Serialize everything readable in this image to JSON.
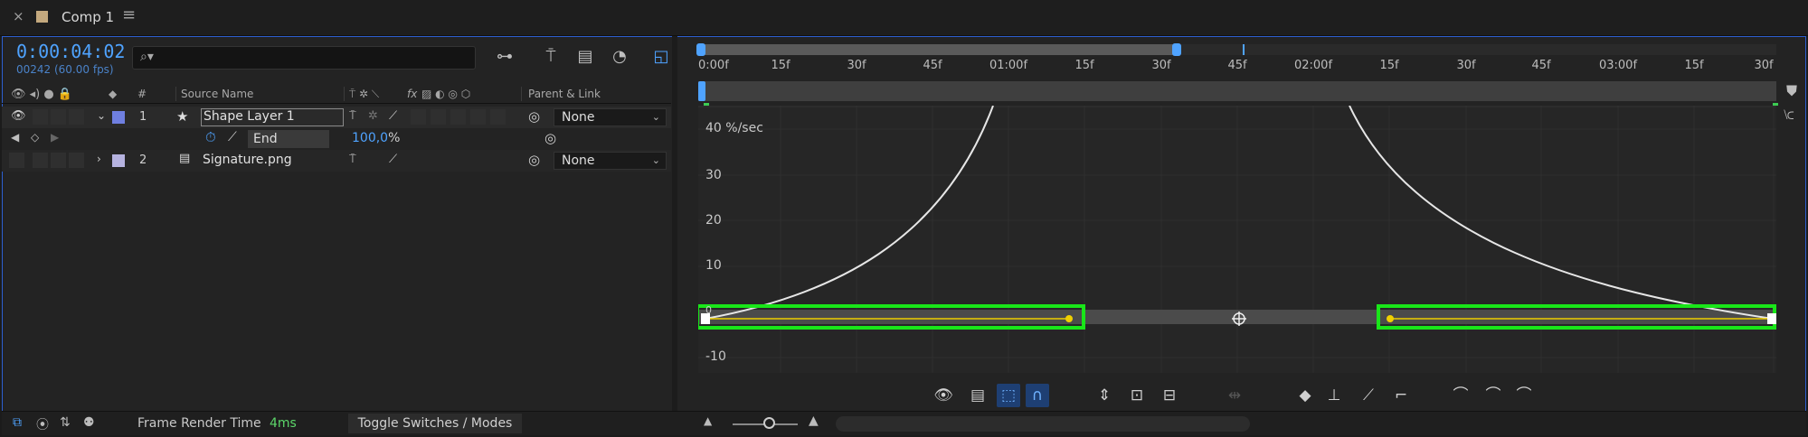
{
  "tab": {
    "close_icon": "close-icon",
    "title": "Comp 1",
    "menu_icon": "hamburger-menu-icon",
    "swatch_color": "#c4a97e"
  },
  "timecode": "0:00:04:02",
  "frame_info": "00242 (60.00 fps)",
  "search": {
    "value": "",
    "icon": "search-icon"
  },
  "toolbar_icons": [
    "composition-flowchart-icon",
    "shy-layers-icon",
    "frame-blending-icon",
    "motion-blur-icon",
    "graph-editor-icon"
  ],
  "columns": {
    "source_name": "Source Name",
    "parent_link": "Parent & Link",
    "number": "#",
    "fx": "fx"
  },
  "layers": [
    {
      "number": "1",
      "name": "Shape Layer 1",
      "label_color": "#6f7fe0",
      "type_icon": "star-shape-icon",
      "parent": "None",
      "expanded": true
    },
    {
      "number": "2",
      "name": "Signature.png",
      "label_color": "#b6b3e0",
      "type_icon": "image-file-icon",
      "parent": "None",
      "expanded": false
    }
  ],
  "property": {
    "name": "End",
    "value_number": "100,0",
    "value_unit": "%"
  },
  "ruler": {
    "ticks": [
      "0:00f",
      "15f",
      "30f",
      "45f",
      "01:00f",
      "15f",
      "30f",
      "45f",
      "02:00f",
      "15f",
      "30f",
      "45f",
      "03:00f",
      "15f",
      "30f"
    ]
  },
  "graph": {
    "unit_label": "40 %/sec",
    "y_labels": [
      "30",
      "20",
      "10",
      "0",
      "-10"
    ],
    "curve_color": "#e6e6e6",
    "highlight_color": "#19e619",
    "handle_color": "#f0d000"
  },
  "bottom": {
    "frame_render_label": "Frame Render Time",
    "frame_render_value": "4ms",
    "toggle_label": "Toggle Switches / Modes"
  },
  "graph_toolbar": [
    "show-properties-icon",
    "graph-options-icon",
    "transform-box-icon",
    "snap-icon",
    "fit-selection-icon",
    "fit-all-icon",
    "fit-all-curves-icon",
    "separate-dimensions-icon",
    "edit-keyframe-icon",
    "convert-hold-icon",
    "convert-auto-bezier-icon",
    "convert-linear-icon",
    "easy-ease-icon",
    "easy-ease-in-icon",
    "easy-ease-out-icon"
  ]
}
